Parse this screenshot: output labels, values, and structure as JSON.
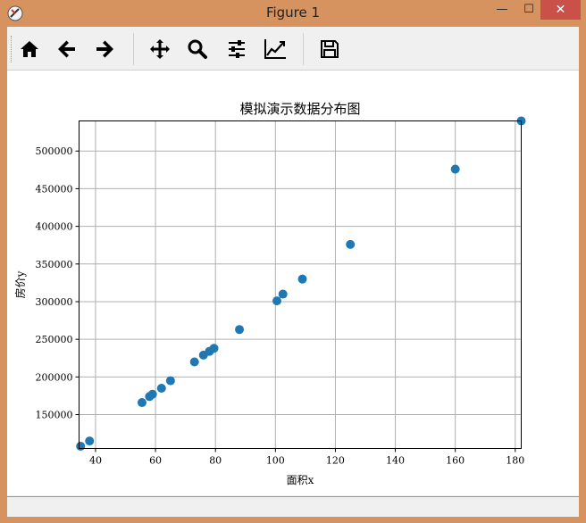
{
  "window": {
    "title": "Figure 1",
    "min_glyph": "—",
    "max_glyph": "☐",
    "close_glyph": "✕"
  },
  "toolbar": {
    "buttons": [
      {
        "name": "home-icon"
      },
      {
        "name": "back-arrow-icon"
      },
      {
        "name": "forward-arrow-icon"
      },
      {
        "name": "pan-icon"
      },
      {
        "name": "zoom-icon"
      },
      {
        "name": "subplots-config-icon"
      },
      {
        "name": "edit-axes-icon"
      },
      {
        "name": "save-icon"
      }
    ]
  },
  "chart_data": {
    "type": "scatter",
    "title": "模拟演示数据分布图",
    "xlabel": "面积x",
    "ylabel": "房价y",
    "xlim": [
      34.5,
      182
    ],
    "ylim": [
      105000,
      540000
    ],
    "xticks": [
      40,
      60,
      80,
      100,
      120,
      140,
      160,
      180
    ],
    "yticks": [
      150000,
      200000,
      250000,
      300000,
      350000,
      400000,
      450000,
      500000
    ],
    "grid": true,
    "color": "#1f77b4",
    "points": [
      [
        35,
        108000
      ],
      [
        38,
        115000
      ],
      [
        55.5,
        166000
      ],
      [
        58,
        174000
      ],
      [
        59,
        177000
      ],
      [
        62,
        185000
      ],
      [
        65,
        195000
      ],
      [
        73,
        220000
      ],
      [
        76,
        229000
      ],
      [
        78,
        234000
      ],
      [
        79.5,
        238000
      ],
      [
        88,
        263000
      ],
      [
        100.5,
        301000
      ],
      [
        102.5,
        310000
      ],
      [
        109,
        330000
      ],
      [
        125,
        376000
      ],
      [
        160,
        476000
      ],
      [
        182,
        540000
      ]
    ]
  }
}
